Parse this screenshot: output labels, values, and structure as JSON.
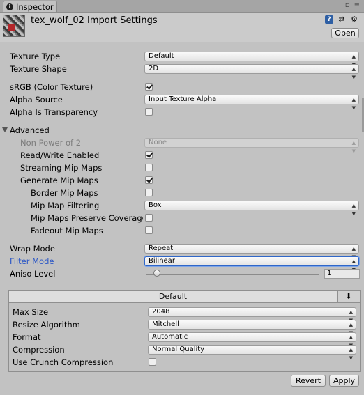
{
  "tab": {
    "label": "Inspector",
    "icon": "info-icon"
  },
  "header": {
    "title": "tex_wolf_02 Import Settings",
    "open_label": "Open",
    "icons": [
      "help-icon",
      "preset-icon",
      "gear-icon"
    ]
  },
  "fields": {
    "texture_type": {
      "label": "Texture Type",
      "value": "Default"
    },
    "texture_shape": {
      "label": "Texture Shape",
      "value": "2D"
    },
    "srgb": {
      "label": "sRGB (Color Texture)",
      "checked": true
    },
    "alpha_source": {
      "label": "Alpha Source",
      "value": "Input Texture Alpha"
    },
    "alpha_transparency": {
      "label": "Alpha Is Transparency",
      "checked": false
    },
    "advanced": {
      "label": "Advanced"
    },
    "non_power_2": {
      "label": "Non Power of 2",
      "value": "None"
    },
    "read_write": {
      "label": "Read/Write Enabled",
      "checked": true
    },
    "streaming_mips": {
      "label": "Streaming Mip Maps",
      "checked": false
    },
    "generate_mips": {
      "label": "Generate Mip Maps",
      "checked": true
    },
    "border_mips": {
      "label": "Border Mip Maps",
      "checked": false
    },
    "mip_filtering": {
      "label": "Mip Map Filtering",
      "value": "Box"
    },
    "mip_preserve": {
      "label": "Mip Maps Preserve Coverage",
      "checked": false
    },
    "fadeout_mips": {
      "label": "Fadeout Mip Maps",
      "checked": false
    },
    "wrap_mode": {
      "label": "Wrap Mode",
      "value": "Repeat"
    },
    "filter_mode": {
      "label": "Filter Mode",
      "value": "Bilinear"
    },
    "aniso_level": {
      "label": "Aniso Level",
      "value": "1",
      "level": 1
    }
  },
  "platform": {
    "tab_label": "Default",
    "download_icon": "download-icon",
    "max_size": {
      "label": "Max Size",
      "value": "2048"
    },
    "resize": {
      "label": "Resize Algorithm",
      "value": "Mitchell"
    },
    "format": {
      "label": "Format",
      "value": "Automatic"
    },
    "compression": {
      "label": "Compression",
      "value": "Normal Quality"
    },
    "crunch": {
      "label": "Use Crunch Compression",
      "checked": false
    }
  },
  "footer": {
    "revert_label": "Revert",
    "apply_label": "Apply"
  },
  "colors": {
    "background": "#c2c2c2",
    "highlight_label": "#2a56c6",
    "focus_border": "#2f66c8"
  }
}
